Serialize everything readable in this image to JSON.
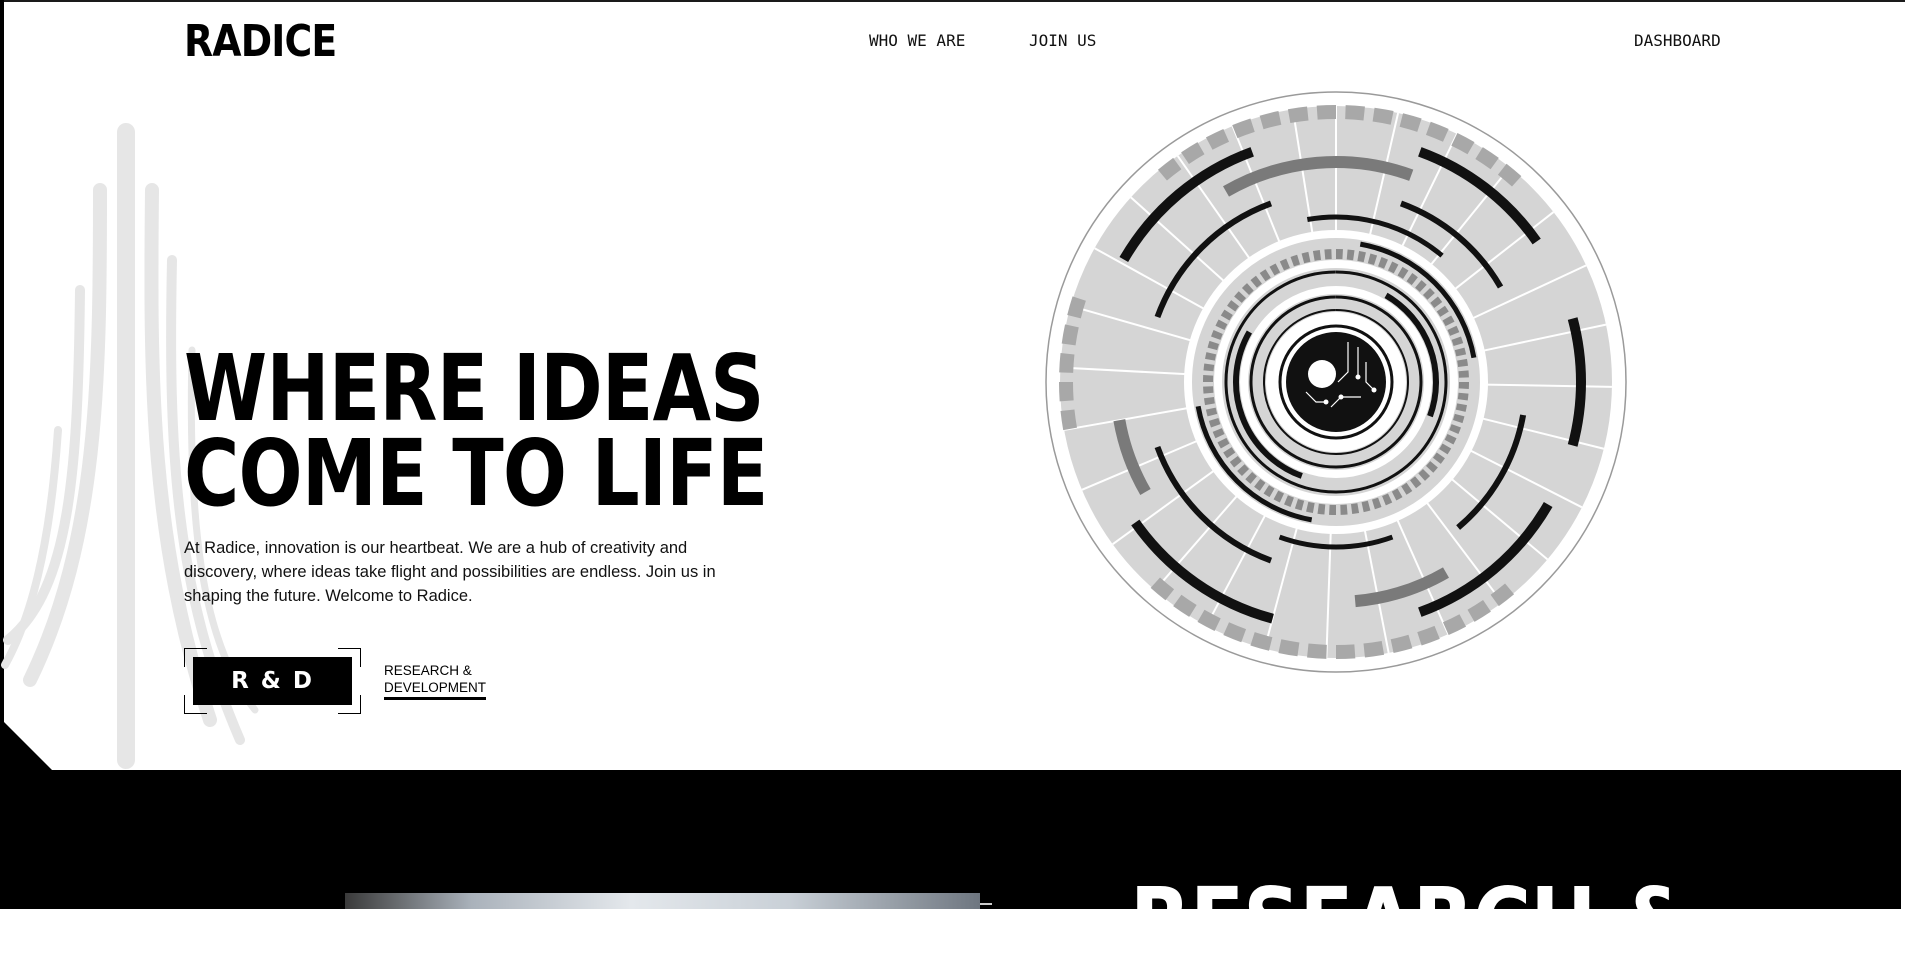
{
  "header": {
    "logo": "RADICE",
    "nav": [
      {
        "label": "WHO WE ARE"
      },
      {
        "label": "JOIN US"
      }
    ],
    "dashboard_label": "DASHBOARD"
  },
  "hero": {
    "title_line1": "WHERE IDEAS",
    "title_line2": "COME TO LIFE",
    "description": "At Radice, innovation is our heartbeat. We are a hub of creativity and discovery, where ideas take flight and possibilities are endless. Join us in shaping the future. Welcome to Radice.",
    "rd_button_label": "R & D",
    "rd_link_line1": "RESEARCH &",
    "rd_link_line2": "DEVELOPMENT"
  },
  "section": {
    "heading": "RESEARCH &"
  },
  "colors": {
    "background": "#ffffff",
    "text": "#000000",
    "accent_dark": "#000000",
    "decor_gray": "#e6e6e6",
    "ring_light": "#d5d5d5",
    "ring_mid": "#7a7a7a",
    "ring_dark": "#111111"
  },
  "icons": {
    "hero_graphic": "circuit-eye-icon",
    "background_decor": "curved-lines-decor"
  }
}
